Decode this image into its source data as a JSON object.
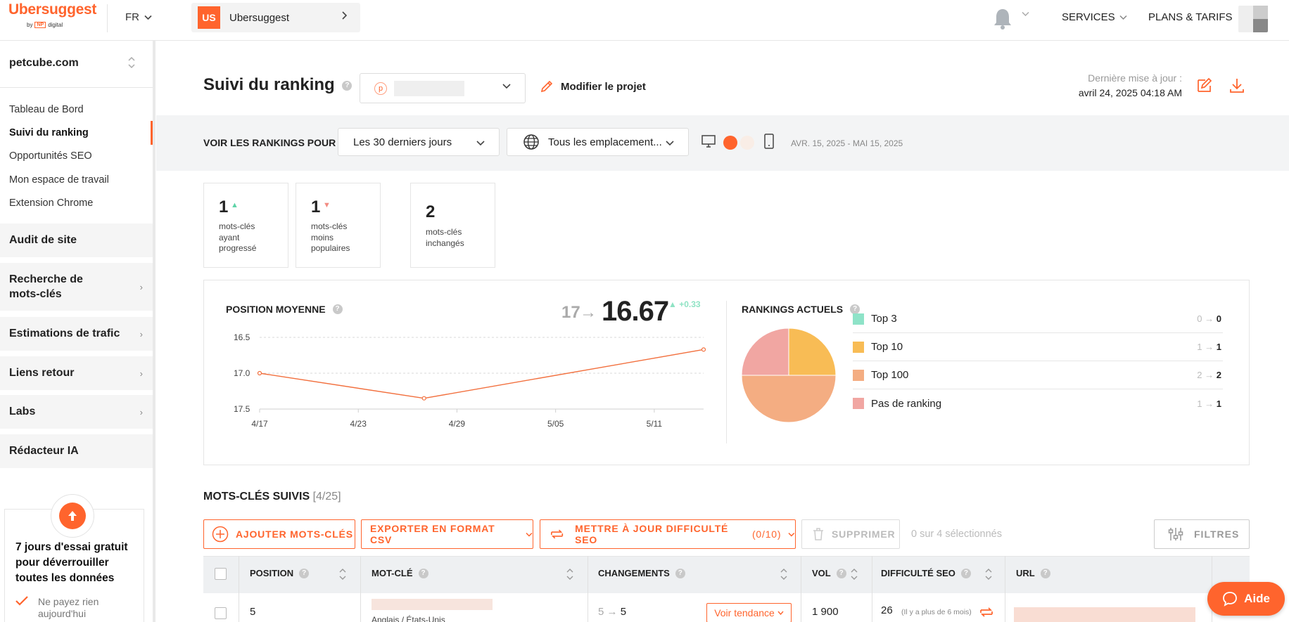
{
  "brand": {
    "name": "Ubersuggest",
    "by": "by",
    "np": "NP",
    "digital": "digital"
  },
  "top": {
    "lang": "FR",
    "project_badge": "US",
    "project_name": "Ubersuggest",
    "services": "SERVICES",
    "plans": "PLANS & TARIFS"
  },
  "sidebar": {
    "project": "petcube.com",
    "sub_items": [
      "Tableau de Bord",
      "Suivi du ranking",
      "Opportunités SEO",
      "Mon espace de travail",
      "Extension Chrome"
    ],
    "sections": [
      "Audit de site",
      "Recherche de mots-clés",
      "Estimations de trafic",
      "Liens retour",
      "Labs",
      "Rédacteur IA"
    ],
    "trial_title": "7 jours d'essai gratuit pour déverrouiller toutes les données",
    "trial_note": "Ne payez rien aujourd'hui"
  },
  "header": {
    "title": "Suivi du ranking",
    "domain_initial": "p",
    "edit_project": "Modifier le projet",
    "last_update_label": "Dernière mise à jour :",
    "last_update_value": "avril 24, 2025 04:18 AM"
  },
  "filters": {
    "label": "VOIR LES RANKINGS POUR :",
    "period": "Les 30 derniers jours",
    "location": "Tous les emplacement...",
    "date_range": "AVR. 15, 2025 - MAI 15, 2025"
  },
  "stats": [
    {
      "value": "1",
      "label": "mots-clés ayant progressé",
      "trend": "up"
    },
    {
      "value": "1",
      "label": "mots-clés moins populaires",
      "trend": "down"
    },
    {
      "value": "2",
      "label": "mots-clés inchangés",
      "trend": "none"
    }
  ],
  "avg_position": {
    "title": "POSITION MOYENNE",
    "from": "17",
    "arrow": "→",
    "to": "16.67",
    "delta": "+0.33"
  },
  "current_rankings": {
    "title": "RANKINGS ACTUELS",
    "rows": [
      {
        "name": "Top 3",
        "from": "0",
        "to": "0",
        "color": "#8ee3c8"
      },
      {
        "name": "Top 10",
        "from": "1",
        "to": "1",
        "color": "#f8bc55"
      },
      {
        "name": "Top 100",
        "from": "2",
        "to": "2",
        "color": "#f4ad82"
      },
      {
        "name": "Pas de ranking",
        "from": "1",
        "to": "1",
        "color": "#f1a6a2"
      }
    ]
  },
  "chart_data": [
    {
      "type": "line",
      "title": "POSITION MOYENNE",
      "x": [
        "4/17",
        "4/27",
        "5/14"
      ],
      "series": [
        {
          "values": [
            17.0,
            17.35,
            16.67
          ]
        }
      ],
      "x_ticks": [
        "4/17",
        "4/23",
        "4/29",
        "5/05",
        "5/11"
      ],
      "y_ticks": [
        "16.5",
        "17.0",
        "17.5"
      ],
      "ylim": [
        17.5,
        16.5
      ],
      "y_reversed": true,
      "grid": true,
      "color": "#f26f3d"
    },
    {
      "type": "pie",
      "title": "RANKINGS ACTUELS",
      "categories": [
        "Top 3",
        "Top 10",
        "Top 100",
        "Pas de ranking"
      ],
      "values": [
        0,
        1,
        2,
        1
      ],
      "colors": [
        "#8ee3c8",
        "#f8bc55",
        "#f4ad82",
        "#f1a6a2"
      ]
    }
  ],
  "keywords": {
    "title": "MOTS-CLÉS SUIVIS",
    "count": "[4/25]",
    "btn_add": "AJOUTER MOTS-CLÉS",
    "btn_export": "EXPORTER EN FORMAT CSV",
    "btn_update": "METTRE À JOUR DIFFICULTÉ SEO",
    "btn_update_count": "(0/10)",
    "btn_delete": "SUPPRIMER",
    "selected": "0 sur 4 sélectionnés",
    "btn_filters": "FILTRES",
    "columns": [
      "POSITION",
      "MOT-CLÉ",
      "CHANGEMENTS",
      "VOL",
      "DIFFICULTÉ SEO",
      "URL"
    ],
    "row": {
      "position": "5",
      "keyword_meta": "Anglais / États-Unis",
      "change_from": "5",
      "change_to": "5",
      "trend_btn": "Voir tendance",
      "volume": "1 900",
      "difficulty": "26",
      "difficulty_note": "(Il y a plus de 6 mois)"
    }
  },
  "help_btn": "Aide"
}
